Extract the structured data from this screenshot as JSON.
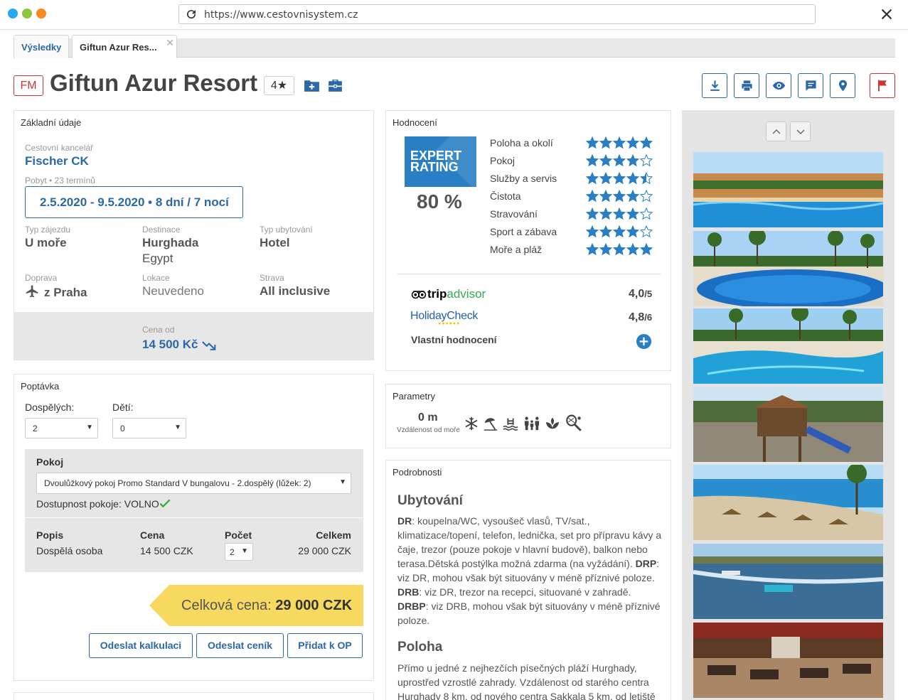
{
  "browser": {
    "url": "https://www.cestovnisystem.cz"
  },
  "tabs": [
    {
      "label": "Výsledky"
    },
    {
      "label": "Giftun Azur Res..."
    }
  ],
  "header": {
    "badge": "FM",
    "title": "Giftun Azur Resort",
    "stars": "4★"
  },
  "basic": {
    "heading": "Základní údaje",
    "agency_label": "Cestovní kancelář",
    "agency": "Fischer CK",
    "stay_label": "Pobyt • 23 termínů",
    "dates": "2.5.2020 - 9.5.2020 • 8 dní / 7 nocí",
    "type_label": "Typ zájezdu",
    "type": "U moře",
    "dest_label": "Destinace",
    "dest_city": "Hurghada",
    "dest_country": "Egypt",
    "acc_label": "Typ ubytování",
    "acc": "Hotel",
    "transport_label": "Doprava",
    "transport": "z Praha",
    "location_label": "Lokace",
    "location": "Neuvedeno",
    "board_label": "Strava",
    "board": "All inclusive",
    "price_label": "Cena od",
    "price": "14 500 Kč"
  },
  "rating": {
    "heading": "Hodnocení",
    "expert_line1": "EXPERT",
    "expert_line2": "RATING",
    "percent": "80 %",
    "categories": [
      {
        "name": "Poloha a okolí",
        "stars": 5
      },
      {
        "name": "Pokoj",
        "stars": 4
      },
      {
        "name": "Služby a servis",
        "stars": 4.5
      },
      {
        "name": "Čistota",
        "stars": 4
      },
      {
        "name": "Stravování",
        "stars": 4
      },
      {
        "name": "Sport a zábava",
        "stars": 4
      },
      {
        "name": "Moře a pláž",
        "stars": 5
      }
    ],
    "tripadvisor_a": "trip",
    "tripadvisor_b": "advisor",
    "tripadvisor_score": "4,0",
    "tripadvisor_max": "/5",
    "holidaycheck": "HolidayCheck",
    "holidaycheck_score": "4,8",
    "holidaycheck_max": "/6",
    "own_rating": "Vlastní hodnocení"
  },
  "params": {
    "heading": "Parametry",
    "distance": "0 m",
    "distance_label": "Vzdálenost od moře"
  },
  "details": {
    "heading": "Podrobnosti",
    "h1": "Ubytování",
    "p1": [
      {
        "bold": "DR",
        "text": ": koupelna/WC, vysoušeč vlasů, TV/sat., klimatizace/topení, telefon, lednička, set pro přípravu kávy a čaje, trezor (pouze pokoje v hlavní budově), balkon nebo terasa.Dětská postýlka možná zdarma (na vyžádání). "
      },
      {
        "bold": "DRP",
        "text": ": viz DR, mohou však být situovány v méně příznivé poloze. "
      },
      {
        "bold": "DRB",
        "text": ": viz DR, trezor na recepci, situované v zahradě. "
      },
      {
        "bold": "DRBP",
        "text": ": viz DRB, mohou však být situovány v méně příznivé poloze."
      }
    ],
    "h2": "Poloha",
    "p2": "Přímo u jedné z nejhezčích písečných pláží Hurghady, uprostřed vzrostlé zahrady. Vzdálenost od starého centra Hurghady 8 km, od nového centra Sakkala 5 km, od letiště"
  },
  "inquiry": {
    "heading": "Poptávka",
    "adults_label": "Dospělých:",
    "adults": "2",
    "children_label": "Dětí:",
    "children": "0",
    "room_label": "Pokoj",
    "room": "Dvoulůžkový pokoj Promo Standard V bungalovu - 2.dospělý (lůžek: 2)",
    "availability": "Dostupnost pokoje: VOLNO",
    "col_desc": "Popis",
    "col_price": "Cena",
    "col_count": "Počet",
    "col_total": "Celkem",
    "row_desc": "Dospělá osoba",
    "row_price": "14 500 CZK",
    "row_count": "2",
    "row_total": "29 000 CZK",
    "total_label": "Celková cena:",
    "total_value": "29 000 CZK",
    "btn_calc": "Odeslat kalkulaci",
    "btn_pricelist": "Odeslat ceník",
    "btn_add": "Přidat k OP"
  },
  "colors": {
    "brand": "#2a68a8",
    "accent_red": "#cc3333",
    "star": "#2a7fc4",
    "total_bg": "#f7d960",
    "check": "#2fae2f"
  }
}
